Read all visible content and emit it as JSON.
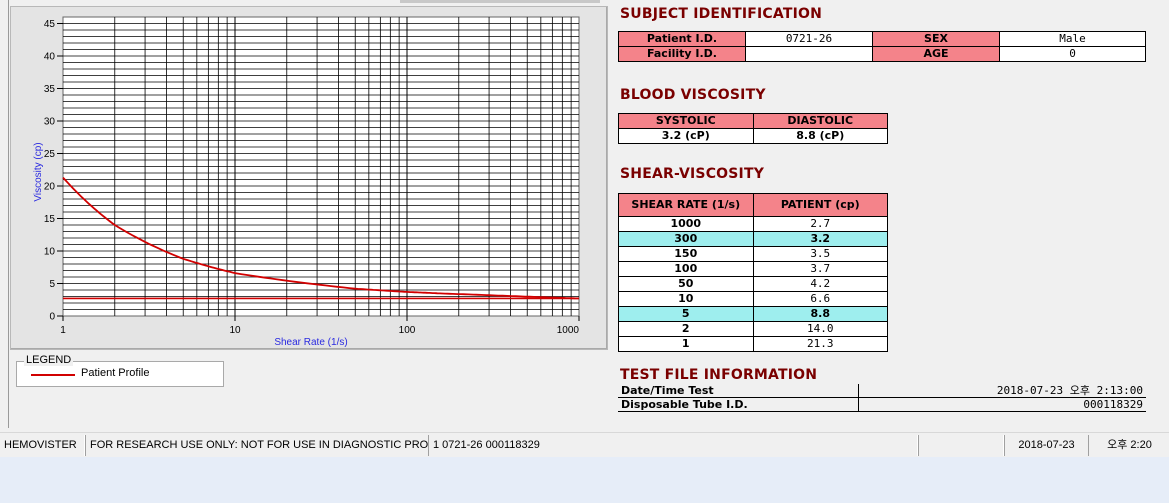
{
  "chart": {
    "ylabel": "Viscosity (cp)",
    "xlabel": "Shear Rate (1/s)",
    "x_ticks": [
      "1",
      "10",
      "100",
      "1000"
    ],
    "y_ticks": [
      "0",
      "5",
      "10",
      "15",
      "20",
      "25",
      "30",
      "35",
      "40",
      "45"
    ]
  },
  "chart_data": {
    "type": "line",
    "title": "",
    "xlabel": "Shear Rate (1/s)",
    "ylabel": "Viscosity (cp)",
    "x_scale": "log",
    "xlim": [
      1,
      1000
    ],
    "ylim": [
      0,
      46
    ],
    "grid": true,
    "legend_position": "bottom-left",
    "series": [
      {
        "name": "Patient Profile",
        "color": "#d10000",
        "x": [
          1,
          2,
          5,
          10,
          50,
          100,
          150,
          300,
          1000
        ],
        "y": [
          21.3,
          14.0,
          8.8,
          6.6,
          4.2,
          3.7,
          3.5,
          3.2,
          2.7
        ]
      }
    ],
    "reference_line": {
      "y": 2.7,
      "color": "#d10000"
    }
  },
  "legend": {
    "title": "LEGEND",
    "items": [
      {
        "label": "Patient Profile",
        "color": "#d10000"
      }
    ]
  },
  "subject": {
    "heading": "SUBJECT IDENTIFICATION",
    "patient_id_label": "Patient I.D.",
    "patient_id": "0721-26",
    "sex_label": "SEX",
    "sex": "Male",
    "facility_id_label": "Facility I.D.",
    "facility_id": "",
    "age_label": "AGE",
    "age": "0"
  },
  "blood_viscosity": {
    "heading": "BLOOD VISCOSITY",
    "systolic_label": "SYSTOLIC",
    "diastolic_label": "DIASTOLIC",
    "systolic": "3.2 (cP)",
    "diastolic": "8.8 (cP)"
  },
  "shear_viscosity": {
    "heading": "SHEAR-VISCOSITY",
    "col_rate": "SHEAR RATE (1/s)",
    "col_patient": "PATIENT (cp)",
    "rows": [
      {
        "rate": "1000",
        "patient": "2.7"
      },
      {
        "rate": "300",
        "patient": "3.2"
      },
      {
        "rate": "150",
        "patient": "3.5"
      },
      {
        "rate": "100",
        "patient": "3.7"
      },
      {
        "rate": "50",
        "patient": "4.2"
      },
      {
        "rate": "10",
        "patient": "6.6"
      },
      {
        "rate": "5",
        "patient": "8.8"
      },
      {
        "rate": "2",
        "patient": "14.0"
      },
      {
        "rate": "1",
        "patient": "21.3"
      }
    ],
    "highlight_color": "#9eeeee"
  },
  "test_file": {
    "heading": "TEST FILE INFORMATION",
    "datetime_label": "Date/Time Test",
    "datetime": "2018-07-23  오후 2:13:00",
    "tube_label": "Disposable Tube I.D.",
    "tube_id": "000118329"
  },
  "status_bar": {
    "app": "HEMOVISTER",
    "notice": "FOR RESEARCH USE ONLY: NOT FOR USE IN DIAGNOSTIC PROCEDURES",
    "record": "1  0721-26  000118329",
    "empty": "",
    "date": "2018-07-23",
    "time": "오후 2:20"
  },
  "colors": {
    "heading": "#7a0000",
    "header_cell": "#f4838a",
    "curve": "#d10000"
  }
}
